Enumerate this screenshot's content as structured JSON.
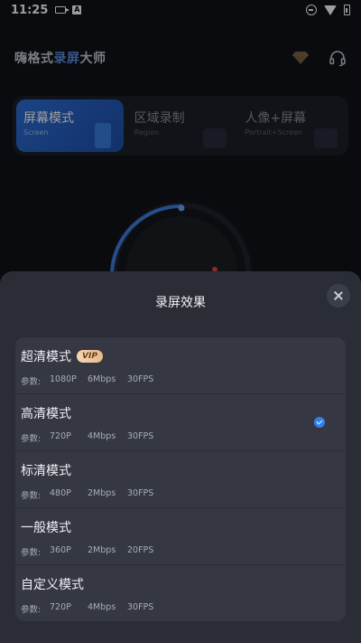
{
  "status_bar": {
    "time": "11:25",
    "badge_letter": "A"
  },
  "header": {
    "title_part1": "嗨格式",
    "title_part2": "录屏",
    "title_part3": "大师",
    "icons": [
      "diamond-icon",
      "headset-icon"
    ]
  },
  "mode_tabs": [
    {
      "label": "屏幕模式",
      "sub": "Screen",
      "active": true
    },
    {
      "label": "区域录制",
      "sub": "Region",
      "active": false
    },
    {
      "label": "人像+屏幕",
      "sub": "Portrait+Screen",
      "active": false
    }
  ],
  "sheet": {
    "title": "录屏效果",
    "param_label": "参数:",
    "items": [
      {
        "name": "超清模式",
        "vip": "VIP",
        "resolution": "1080P",
        "bitrate": "6Mbps",
        "fps": "30FPS",
        "selected": false
      },
      {
        "name": "高清模式",
        "resolution": "720P",
        "bitrate": "4Mbps",
        "fps": "30FPS",
        "selected": true
      },
      {
        "name": "标清模式",
        "resolution": "480P",
        "bitrate": "2Mbps",
        "fps": "30FPS",
        "selected": false
      },
      {
        "name": "一般模式",
        "resolution": "360P",
        "bitrate": "2Mbps",
        "fps": "20FPS",
        "selected": false
      },
      {
        "name": "自定义模式",
        "resolution": "720P",
        "bitrate": "4Mbps",
        "fps": "30FPS",
        "selected": false
      }
    ]
  },
  "colors": {
    "accent": "#2f80ed",
    "sheet_bg": "#2a2d35",
    "list_bg": "#353842",
    "vip_gold": "#e9b88c"
  }
}
